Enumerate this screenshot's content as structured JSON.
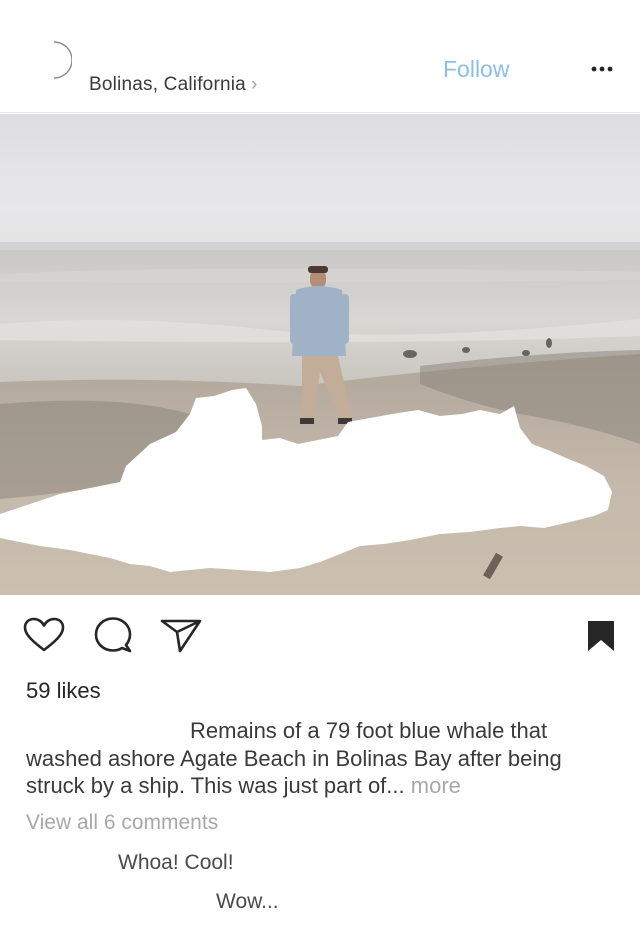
{
  "post": {
    "location": "Bolinas, California",
    "location_chevron": "›",
    "follow_label": "Follow",
    "more_icon": "ellipsis-icon",
    "likes": "59 likes",
    "caption": "Remains of a 79 foot blue whale that washed ashore Agate Beach in Bolinas Bay after being struck by a ship. This was just part of...",
    "caption_more": "more",
    "view_comments": "View all 6 comments",
    "comments": [
      {
        "text": "Whoa! Cool!"
      },
      {
        "text": "Wow..."
      }
    ]
  },
  "icons": {
    "like": "heart-icon",
    "comment": "comment-bubble-icon",
    "share": "paper-plane-icon",
    "save": "bookmark-icon"
  },
  "colors": {
    "follow": "#8cbfe8",
    "muted": "#a8a8a8",
    "text": "#262626"
  }
}
